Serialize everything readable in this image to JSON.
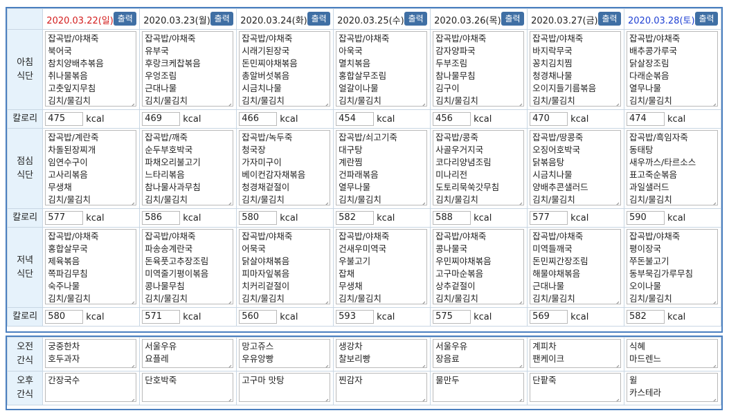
{
  "header": {
    "button_label": "출력",
    "dates": [
      "2020.03.22(일)",
      "2020.03.23(월)",
      "2020.03.24(화)",
      "2020.03.25(수)",
      "2020.03.26(목)",
      "2020.03.27(금)",
      "2020.03.28(토)"
    ]
  },
  "labels": {
    "breakfast": [
      "아침",
      "식단"
    ],
    "lunch": [
      "점심",
      "식단"
    ],
    "dinner": [
      "저녁",
      "식단"
    ],
    "calorie": "칼로리",
    "am_snack": [
      "오전",
      "간식"
    ],
    "pm_snack": [
      "오후",
      "간식"
    ],
    "kcal_unit": "kcal"
  },
  "breakfast": [
    [
      "잡곡밥/야채죽",
      "북어국",
      "참치양배추볶음",
      "취나물볶음",
      "고춧잎지무침",
      "김치/물김치"
    ],
    [
      "잡곡밥/야채죽",
      "유부국",
      "후랑크케찹볶음",
      "우엉조림",
      "근대나물",
      "김치/물김치"
    ],
    [
      "잡곡밥/야채죽",
      "시래기된장국",
      "돈민찌야채볶음",
      "총알버섯볶음",
      "시금치나물",
      "김치/물김치"
    ],
    [
      "잡곡밥/야채죽",
      "아욱국",
      "멸치볶음",
      "홍합살무조림",
      "얼갈이나물",
      "김치/물김치"
    ],
    [
      "잡곡밥/야채죽",
      "감자양파국",
      "두부조림",
      "참나물무침",
      "김구이",
      "김치/물김치"
    ],
    [
      "잡곡밥/야채죽",
      "바지락무국",
      "꽁치김치찜",
      "청경채나물",
      "오이지들기름볶음",
      "김치/물김치"
    ],
    [
      "잡곡밥/야채죽",
      "배추콩가루국",
      "닭살장조림",
      "다래순볶음",
      "열무나물",
      "김치/물김치"
    ]
  ],
  "breakfast_kcal": [
    "475",
    "469",
    "466",
    "454",
    "456",
    "470",
    "474"
  ],
  "lunch": [
    [
      "잡곡밥/계란죽",
      "차돌된장찌개",
      "임연수구이",
      "고사리볶음",
      "무생채",
      "김치/물김치"
    ],
    [
      "잡곡밥/깨죽",
      "순두부호박국",
      "파채오리불고기",
      "느타리볶음",
      "참나물사과무침",
      "김치/물김치"
    ],
    [
      "잡곡밥/녹두죽",
      "청국장",
      "가자미구이",
      "베이컨감자채볶음",
      "청경채겉절이",
      "김치/물김치"
    ],
    [
      "잡곡밥/쇠고기죽",
      "대구탕",
      "계란찜",
      "건파래볶음",
      "열무나물",
      "김치/물김치"
    ],
    [
      "잡곡밥/콩죽",
      "사골우거지국",
      "코다리양념조림",
      "미나리전",
      "도토리묵쑥갓무침",
      "김치/물김치"
    ],
    [
      "잡곡밥/땅콩죽",
      "오징어호박국",
      "닭볶음탕",
      "시금치나물",
      "양배추콘샐러드",
      "김치/물김치"
    ],
    [
      "잡곡밥/흑임자죽",
      "동태탕",
      "새우까스/타르소스",
      "표고죽순볶음",
      "과일샐러드",
      "김치/물김치"
    ]
  ],
  "lunch_kcal": [
    "577",
    "586",
    "580",
    "582",
    "588",
    "577",
    "590"
  ],
  "dinner": [
    [
      "잡곡밥/야채죽",
      "홍합살무국",
      "제육볶음",
      "쪽파김무침",
      "숙주나물",
      "김치/물김치"
    ],
    [
      "잡곡밥/야채죽",
      "파송송계란국",
      "돈육풋고추장조림",
      "미역줄기평이볶음",
      "콩나물무침",
      "김치/물김치"
    ],
    [
      "잡곡밥/야채죽",
      "어묵국",
      "닭살야채볶음",
      "피마자잎볶음",
      "치커리겉절이",
      "김치/물김치"
    ],
    [
      "잡곡밥/야채죽",
      "건새우미역국",
      "우불고기",
      "잡채",
      "무생채",
      "김치/물김치"
    ],
    [
      "잡곡밥/야채죽",
      "콩나물국",
      "우민찌야채볶음",
      "고구마순볶음",
      "상추겉절이",
      "김치/물김치"
    ],
    [
      "잡곡밥/야채죽",
      "미역들깨국",
      "돈민찌간장조림",
      "해물야채볶음",
      "근대나물",
      "김치/물김치"
    ],
    [
      "잡곡밥/야채죽",
      "평이장국",
      "쭈돈불고기",
      "동부묵김가루무침",
      "오이나물",
      "김치/물김치"
    ]
  ],
  "dinner_kcal": [
    "580",
    "571",
    "560",
    "593",
    "575",
    "569",
    "582"
  ],
  "am_snack": [
    [
      "궁중한차",
      "호두과자"
    ],
    [
      "서울우유",
      "요플레"
    ],
    [
      "망고쥬스",
      "우유앙빵"
    ],
    [
      "생강차",
      "찰보리빵"
    ],
    [
      "서울우유",
      "장음료"
    ],
    [
      "계피차",
      "팬케이크"
    ],
    [
      "식혜",
      "마드렌느"
    ]
  ],
  "pm_snack": [
    [
      "간장국수"
    ],
    [
      "단호박죽"
    ],
    [
      "고구마 맛탕"
    ],
    [
      "찐감자"
    ],
    [
      "물만두"
    ],
    [
      "단팥죽"
    ],
    [
      "윌",
      "카스테라"
    ]
  ]
}
